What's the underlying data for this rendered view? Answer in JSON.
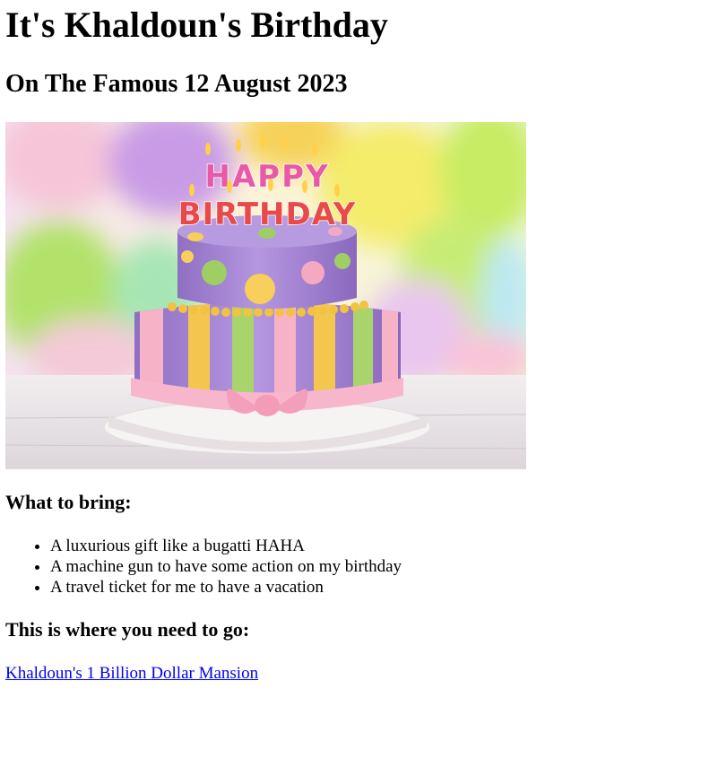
{
  "title": "It's Khaldoun's Birthday",
  "subtitle": "On The Famous 12 August 2023",
  "image": {
    "cake_text_top": "HAPPY",
    "cake_text_bottom": "BIRTHDAY",
    "colors": {
      "cake_purple": "#a98ad6",
      "stripe_yellow": "#f4c64e",
      "stripe_green": "#a9d46b",
      "stripe_pink": "#f6b3c8",
      "dot_green": "#9fcf63",
      "dot_pink": "#f4a9c0",
      "dot_yellow": "#f7cf5a",
      "ribbon_pink": "#f7b6cb"
    }
  },
  "bring": {
    "heading": "What to bring:",
    "items": [
      "A luxurious gift like a bugatti HAHA",
      "A machine gun to have some action on my birthday",
      "A travel ticket for me to have a vacation"
    ]
  },
  "location": {
    "heading": "This is where you need to go:",
    "link_text": "Khaldoun's 1 Billion Dollar Mansion"
  }
}
